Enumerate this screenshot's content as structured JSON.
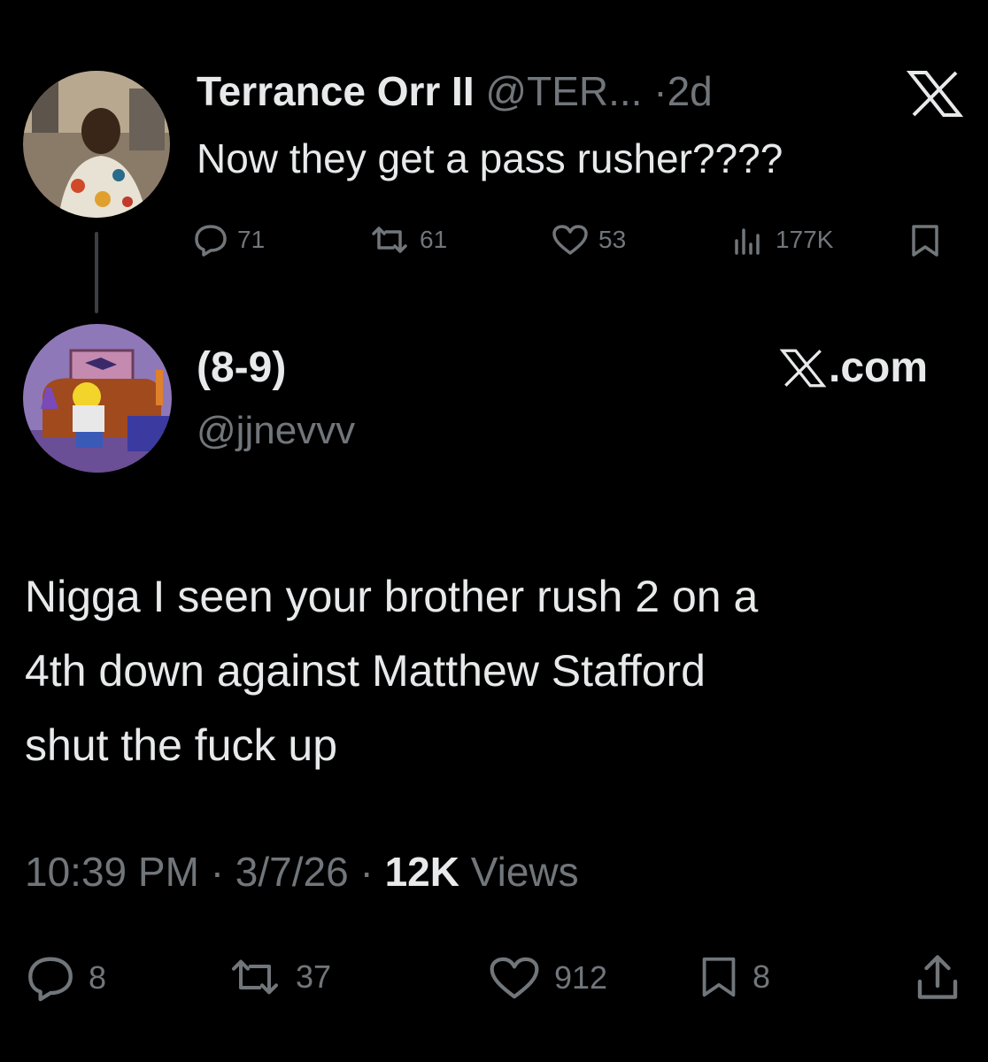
{
  "reply": {
    "name": "Terrance Orr II",
    "handle": "@TER...",
    "separator": "·",
    "time": "2d",
    "text": "Now they get a pass rusher????",
    "metrics": {
      "replies": "71",
      "reposts": "61",
      "likes": "53",
      "views": "177K"
    },
    "icons": [
      "x-logo-icon",
      "reply-icon",
      "repost-icon",
      "like-icon",
      "views-icon",
      "bookmark-icon"
    ]
  },
  "quote": {
    "name": "(8-9)",
    "handle": "@jjnevvv",
    "source_suffix": ".com",
    "text_lines": [
      "Nigga I seen your brother rush 2 on a",
      "4th down against Matthew Stafford",
      "shut the fuck up"
    ],
    "time": "10:39 PM",
    "sep1": "·",
    "date": "3/7/26",
    "sep2": "·",
    "views_count": "12K",
    "views_label": "Views",
    "actions": {
      "replies": "8",
      "reposts": "37",
      "likes": "912",
      "bookmarks": "8"
    },
    "icons": [
      "reply-icon",
      "repost-icon",
      "like-icon",
      "bookmark-icon",
      "share-icon"
    ]
  },
  "colors": {
    "background": "#000000",
    "text": "#e7e9ea",
    "muted": "#71767b"
  }
}
